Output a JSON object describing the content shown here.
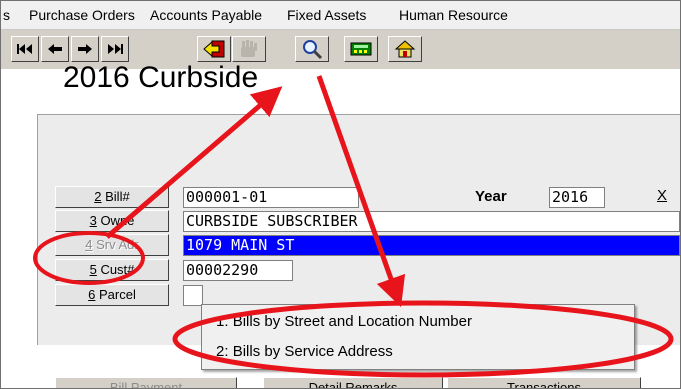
{
  "menubar": {
    "items": [
      "s",
      "Purchase Orders",
      "Accounts Payable",
      "Fixed Assets",
      "Human Resource"
    ]
  },
  "toolbar": {
    "buttons": [
      "first-record-icon",
      "previous-record-icon",
      "next-record-icon",
      "last-record-icon",
      "exit-icon",
      "hand-icon",
      "search-icon",
      "calculator-icon",
      "home-icon"
    ]
  },
  "form": {
    "title": "2016 Curbside",
    "bill_button": {
      "number": "2",
      "text": " Bill#"
    },
    "owner_button": {
      "number": "3",
      "text": " Owne"
    },
    "srv_adr_button": {
      "number": "4",
      "text": " Srv Adr"
    },
    "cust_button": {
      "number": "5",
      "text": " Cust#"
    },
    "parcel_button": {
      "number": "6",
      "text": " Parcel"
    },
    "bill_value": "000001-01",
    "year_label": "Year",
    "year_value": "2016",
    "right_clip_label": "X",
    "owner_value": "CURBSIDE SUBSCRIBER",
    "srv_adr_value": "1079 MAIN ST",
    "cust_value": "00002290"
  },
  "popup": {
    "items": [
      {
        "num": "1:",
        "label": "Bills by Street and Location Number"
      },
      {
        "num": "2:",
        "label": "Bills by Service Address"
      }
    ]
  },
  "bottom_tabs": [
    "Bill Payment",
    "Detail Remarks",
    "Transactions"
  ],
  "annotation": {
    "color": "#e8141c"
  }
}
